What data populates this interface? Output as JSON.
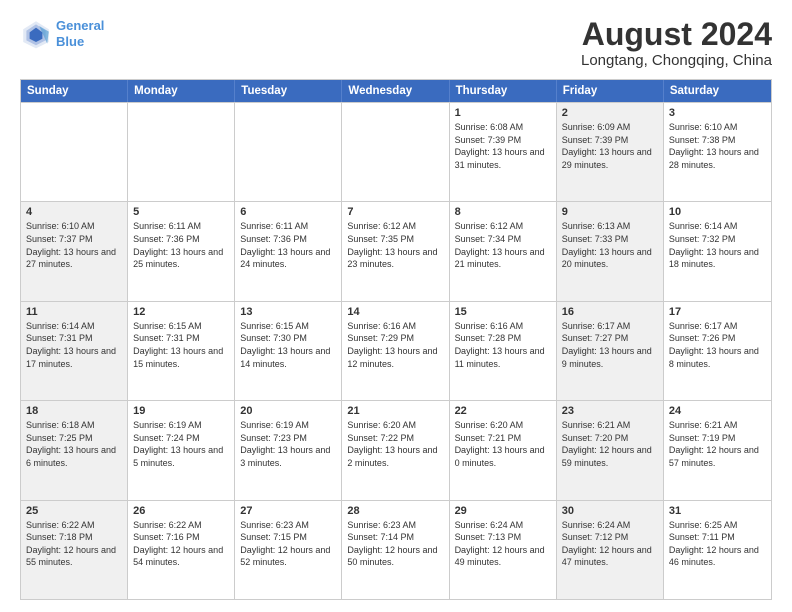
{
  "header": {
    "logo_line1": "General",
    "logo_line2": "Blue",
    "title": "August 2024",
    "subtitle": "Longtang, Chongqing, China"
  },
  "weekdays": [
    "Sunday",
    "Monday",
    "Tuesday",
    "Wednesday",
    "Thursday",
    "Friday",
    "Saturday"
  ],
  "weeks": [
    [
      {
        "day": "",
        "info": "",
        "shade": false
      },
      {
        "day": "",
        "info": "",
        "shade": false
      },
      {
        "day": "",
        "info": "",
        "shade": false
      },
      {
        "day": "",
        "info": "",
        "shade": false
      },
      {
        "day": "1",
        "info": "Sunrise: 6:08 AM\nSunset: 7:39 PM\nDaylight: 13 hours and 31 minutes.",
        "shade": false
      },
      {
        "day": "2",
        "info": "Sunrise: 6:09 AM\nSunset: 7:39 PM\nDaylight: 13 hours and 29 minutes.",
        "shade": true
      },
      {
        "day": "3",
        "info": "Sunrise: 6:10 AM\nSunset: 7:38 PM\nDaylight: 13 hours and 28 minutes.",
        "shade": false
      }
    ],
    [
      {
        "day": "4",
        "info": "Sunrise: 6:10 AM\nSunset: 7:37 PM\nDaylight: 13 hours and 27 minutes.",
        "shade": true
      },
      {
        "day": "5",
        "info": "Sunrise: 6:11 AM\nSunset: 7:36 PM\nDaylight: 13 hours and 25 minutes.",
        "shade": false
      },
      {
        "day": "6",
        "info": "Sunrise: 6:11 AM\nSunset: 7:36 PM\nDaylight: 13 hours and 24 minutes.",
        "shade": false
      },
      {
        "day": "7",
        "info": "Sunrise: 6:12 AM\nSunset: 7:35 PM\nDaylight: 13 hours and 23 minutes.",
        "shade": false
      },
      {
        "day": "8",
        "info": "Sunrise: 6:12 AM\nSunset: 7:34 PM\nDaylight: 13 hours and 21 minutes.",
        "shade": false
      },
      {
        "day": "9",
        "info": "Sunrise: 6:13 AM\nSunset: 7:33 PM\nDaylight: 13 hours and 20 minutes.",
        "shade": true
      },
      {
        "day": "10",
        "info": "Sunrise: 6:14 AM\nSunset: 7:32 PM\nDaylight: 13 hours and 18 minutes.",
        "shade": false
      }
    ],
    [
      {
        "day": "11",
        "info": "Sunrise: 6:14 AM\nSunset: 7:31 PM\nDaylight: 13 hours and 17 minutes.",
        "shade": true
      },
      {
        "day": "12",
        "info": "Sunrise: 6:15 AM\nSunset: 7:31 PM\nDaylight: 13 hours and 15 minutes.",
        "shade": false
      },
      {
        "day": "13",
        "info": "Sunrise: 6:15 AM\nSunset: 7:30 PM\nDaylight: 13 hours and 14 minutes.",
        "shade": false
      },
      {
        "day": "14",
        "info": "Sunrise: 6:16 AM\nSunset: 7:29 PM\nDaylight: 13 hours and 12 minutes.",
        "shade": false
      },
      {
        "day": "15",
        "info": "Sunrise: 6:16 AM\nSunset: 7:28 PM\nDaylight: 13 hours and 11 minutes.",
        "shade": false
      },
      {
        "day": "16",
        "info": "Sunrise: 6:17 AM\nSunset: 7:27 PM\nDaylight: 13 hours and 9 minutes.",
        "shade": true
      },
      {
        "day": "17",
        "info": "Sunrise: 6:17 AM\nSunset: 7:26 PM\nDaylight: 13 hours and 8 minutes.",
        "shade": false
      }
    ],
    [
      {
        "day": "18",
        "info": "Sunrise: 6:18 AM\nSunset: 7:25 PM\nDaylight: 13 hours and 6 minutes.",
        "shade": true
      },
      {
        "day": "19",
        "info": "Sunrise: 6:19 AM\nSunset: 7:24 PM\nDaylight: 13 hours and 5 minutes.",
        "shade": false
      },
      {
        "day": "20",
        "info": "Sunrise: 6:19 AM\nSunset: 7:23 PM\nDaylight: 13 hours and 3 minutes.",
        "shade": false
      },
      {
        "day": "21",
        "info": "Sunrise: 6:20 AM\nSunset: 7:22 PM\nDaylight: 13 hours and 2 minutes.",
        "shade": false
      },
      {
        "day": "22",
        "info": "Sunrise: 6:20 AM\nSunset: 7:21 PM\nDaylight: 13 hours and 0 minutes.",
        "shade": false
      },
      {
        "day": "23",
        "info": "Sunrise: 6:21 AM\nSunset: 7:20 PM\nDaylight: 12 hours and 59 minutes.",
        "shade": true
      },
      {
        "day": "24",
        "info": "Sunrise: 6:21 AM\nSunset: 7:19 PM\nDaylight: 12 hours and 57 minutes.",
        "shade": false
      }
    ],
    [
      {
        "day": "25",
        "info": "Sunrise: 6:22 AM\nSunset: 7:18 PM\nDaylight: 12 hours and 55 minutes.",
        "shade": true
      },
      {
        "day": "26",
        "info": "Sunrise: 6:22 AM\nSunset: 7:16 PM\nDaylight: 12 hours and 54 minutes.",
        "shade": false
      },
      {
        "day": "27",
        "info": "Sunrise: 6:23 AM\nSunset: 7:15 PM\nDaylight: 12 hours and 52 minutes.",
        "shade": false
      },
      {
        "day": "28",
        "info": "Sunrise: 6:23 AM\nSunset: 7:14 PM\nDaylight: 12 hours and 50 minutes.",
        "shade": false
      },
      {
        "day": "29",
        "info": "Sunrise: 6:24 AM\nSunset: 7:13 PM\nDaylight: 12 hours and 49 minutes.",
        "shade": false
      },
      {
        "day": "30",
        "info": "Sunrise: 6:24 AM\nSunset: 7:12 PM\nDaylight: 12 hours and 47 minutes.",
        "shade": true
      },
      {
        "day": "31",
        "info": "Sunrise: 6:25 AM\nSunset: 7:11 PM\nDaylight: 12 hours and 46 minutes.",
        "shade": false
      }
    ]
  ]
}
